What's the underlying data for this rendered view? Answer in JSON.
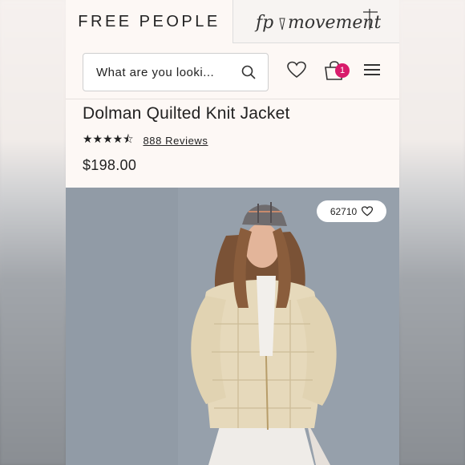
{
  "header": {
    "brand": "FREE PEOPLE",
    "sub_brand": "fpmovement"
  },
  "search": {
    "placeholder": "What are you looki..."
  },
  "cart": {
    "count": "1",
    "badge_color": "#d81b6b"
  },
  "product": {
    "title": "Dolman Quilted Knit Jacket",
    "rating": 4.5,
    "reviews": "888 Reviews",
    "price": "$198.00"
  },
  "image": {
    "likes": "62710"
  },
  "icons": [
    "search-icon",
    "heart-icon",
    "bag-icon",
    "menu-icon"
  ]
}
